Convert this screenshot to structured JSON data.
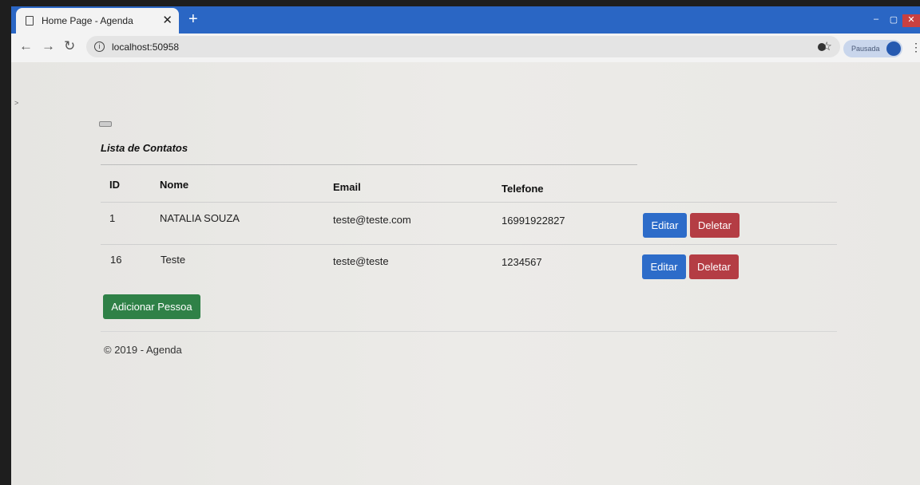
{
  "browser": {
    "tab_title": "Home Page - Agenda",
    "tab_close": "✕",
    "new_tab": "+",
    "url": "localhost:50958",
    "profile_label": "Pausada"
  },
  "page": {
    "heading": "Lista de Contatos",
    "columns": [
      "ID",
      "Nome",
      "Email",
      "Telefone"
    ],
    "rows": [
      {
        "id": "1",
        "nome": "NATALIA SOUZA",
        "email": "teste@teste.com",
        "telefone": "16991922827",
        "edit": "Editar",
        "delete": "Deletar"
      },
      {
        "id": "16",
        "nome": "Teste",
        "email": "teste@teste",
        "telefone": "1234567",
        "edit": "Editar",
        "delete": "Deletar"
      }
    ],
    "add_button": "Adicionar Pessoa",
    "footer": "© 2019 - Agenda"
  },
  "colors": {
    "tab_strip": "#2a66c4",
    "edit_button": "#2d6cc9",
    "delete_button": "#b43d44",
    "add_button": "#2f8147"
  }
}
